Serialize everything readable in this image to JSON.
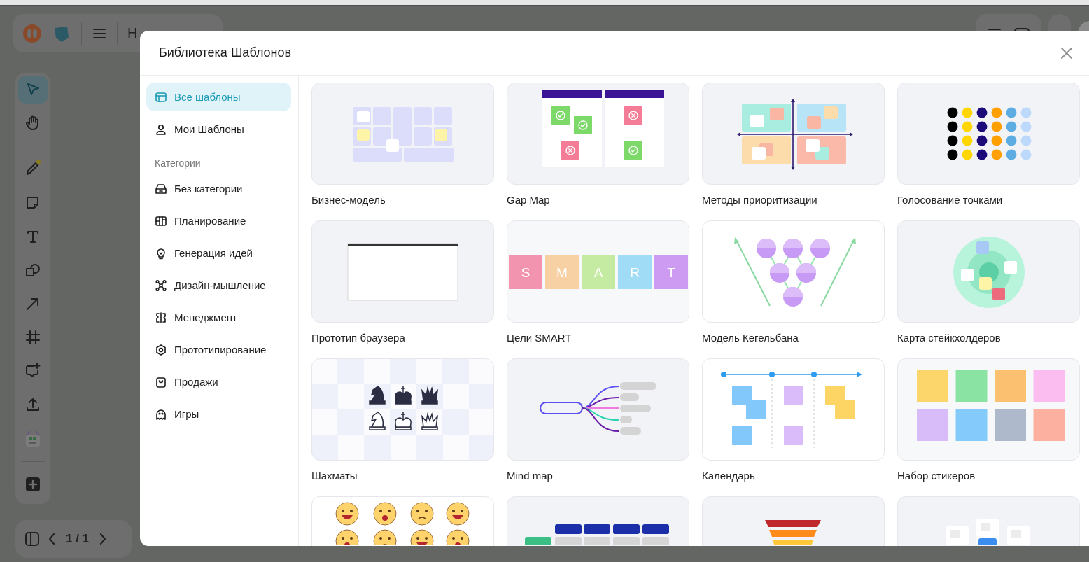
{
  "app": {
    "board_title": "Н",
    "page_indicator": "1 / 1"
  },
  "tools": [
    {
      "kind": "select",
      "selected": true
    },
    {
      "kind": "hand",
      "selected": false
    },
    {
      "kind": "divider"
    },
    {
      "kind": "pen",
      "selected": false
    },
    {
      "kind": "sticky",
      "selected": false
    },
    {
      "kind": "text",
      "selected": false
    },
    {
      "kind": "shapes",
      "selected": false
    },
    {
      "kind": "arrow",
      "selected": false
    },
    {
      "kind": "frame",
      "selected": false
    },
    {
      "kind": "comment",
      "selected": false
    },
    {
      "kind": "upload",
      "selected": false
    },
    {
      "kind": "templates",
      "selected": false
    },
    {
      "kind": "divider"
    },
    {
      "kind": "add",
      "selected": false
    }
  ],
  "modal": {
    "title": "Библиотека Шаблонов",
    "nav": [
      {
        "kind": "layout",
        "label": "Все шаблоны",
        "selected": true
      },
      {
        "kind": "person",
        "label": "Мои Шаблоны",
        "selected": false
      }
    ],
    "categories_heading": "Категории",
    "categories": [
      {
        "kind": "inbox",
        "label": "Без категории",
        "selected": false
      },
      {
        "kind": "columns",
        "label": "Планирование",
        "selected": false
      },
      {
        "kind": "bulb",
        "label": "Генерация идей",
        "selected": false
      },
      {
        "kind": "nodes",
        "label": "Дизайн-мышление",
        "selected": false
      },
      {
        "kind": "split",
        "label": "Менеджмент",
        "selected": false
      },
      {
        "kind": "target",
        "label": "Прототипирование",
        "selected": false
      },
      {
        "kind": "bag",
        "label": "Продажи",
        "selected": false
      },
      {
        "kind": "ghost",
        "label": "Игры",
        "selected": false
      }
    ],
    "templates": [
      {
        "kind": "business",
        "title": "Бизнес-модель"
      },
      {
        "kind": "gap",
        "title": "Gap Map"
      },
      {
        "kind": "quadrant",
        "title": "Методы приоритизации"
      },
      {
        "kind": "dots",
        "title": "Голосование точками"
      },
      {
        "kind": "browser",
        "title": "Прототип браузера"
      },
      {
        "kind": "smart",
        "title": "Цели SMART",
        "letters": [
          "S",
          "M",
          "A",
          "R",
          "T"
        ]
      },
      {
        "kind": "pyramid",
        "title": "Модель Кегельбана"
      },
      {
        "kind": "stakeholder",
        "title": "Карта стейкхолдеров"
      },
      {
        "kind": "chess",
        "title": "Шахматы"
      },
      {
        "kind": "mindmap",
        "title": "Mind map"
      },
      {
        "kind": "calendar",
        "title": "Календарь"
      },
      {
        "kind": "stickers",
        "title": "Набор стикеров"
      },
      {
        "kind": "emoji"
      },
      {
        "kind": "table"
      },
      {
        "kind": "funnel"
      },
      {
        "kind": "cards"
      }
    ]
  }
}
